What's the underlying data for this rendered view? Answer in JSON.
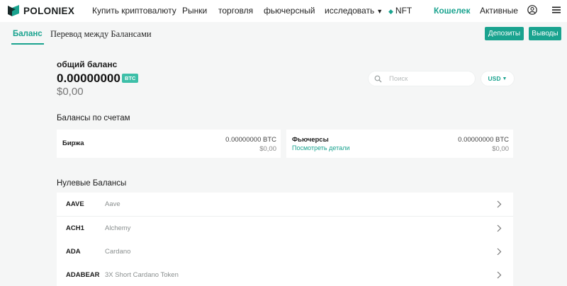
{
  "nav": {
    "brand": "POLONIEX",
    "items": [
      {
        "label": "Купить криптовалюту"
      },
      {
        "label": "Рынки"
      },
      {
        "label": "торговля"
      },
      {
        "label": "фьючерсный"
      },
      {
        "label": "исследовать"
      },
      {
        "label": "NFT"
      },
      {
        "label": "Кошелек"
      },
      {
        "label": "Активные"
      }
    ],
    "accent_color": "#1aa38f"
  },
  "tabs": [
    {
      "label": "Баланс"
    },
    {
      "label": "Перевод между Балансами"
    }
  ],
  "actions": {
    "deposit_label": "Депозиты",
    "withdraw_label": "Выводы"
  },
  "summary": {
    "label": "общий баланс",
    "amount": "0.00000000",
    "currency_badge": "BTC",
    "usd": "$0,00"
  },
  "search": {
    "placeholder": "Поиск"
  },
  "currency_select": {
    "value": "USD"
  },
  "accounts": {
    "title": "Балансы по счетам",
    "items": [
      {
        "name": "Биржа",
        "btc": "0.00000000 BTC",
        "usd": "$0,00"
      },
      {
        "name": "Фьючерсы",
        "link": "Посмотреть детали",
        "btc": "0.00000000 BTC",
        "usd": "$0,00"
      }
    ]
  },
  "zero_balances": {
    "title": "Нулевые Балансы",
    "rows": [
      {
        "ticker": "AAVE",
        "name": "Aave"
      },
      {
        "ticker": "ACH1",
        "name": "Alchemy"
      },
      {
        "ticker": "ADA",
        "name": "Cardano"
      },
      {
        "ticker": "ADABEAR",
        "name": "3X Short Cardano Token"
      }
    ]
  }
}
